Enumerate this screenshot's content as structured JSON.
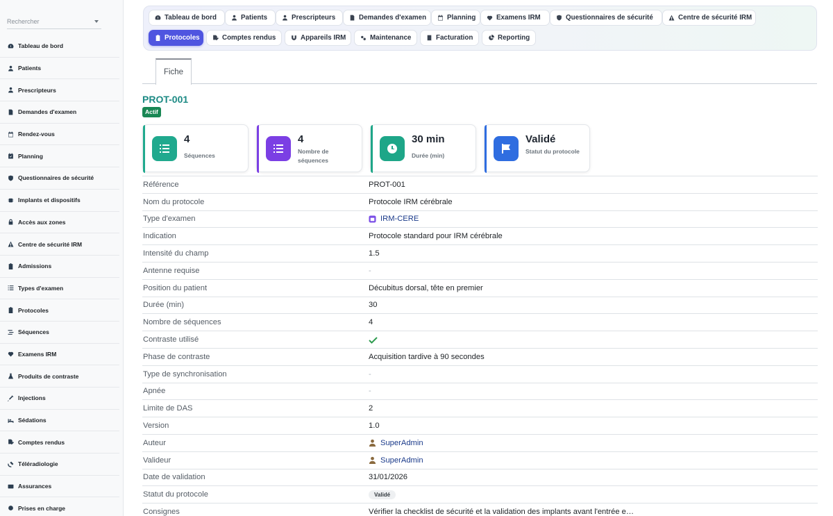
{
  "sidebar": {
    "search_placeholder": "Rechercher",
    "items": [
      {
        "label": "Tableau de bord",
        "icon": "gauge-icon"
      },
      {
        "label": "Patients",
        "icon": "user-icon"
      },
      {
        "label": "Prescripteurs",
        "icon": "user-doctor-icon"
      },
      {
        "label": "Demandes d'examen",
        "icon": "file-icon"
      },
      {
        "label": "Rendez-vous",
        "icon": "calendar-icon"
      },
      {
        "label": "Planning",
        "icon": "calendar-check-icon"
      },
      {
        "label": "Questionnaires de sécurité",
        "icon": "shield-icon"
      },
      {
        "label": "Implants et dispositifs",
        "icon": "microchip-icon"
      },
      {
        "label": "Accès aux zones",
        "icon": "lock-icon"
      },
      {
        "label": "Centre de sécurité IRM",
        "icon": "warning-icon"
      },
      {
        "label": "Admissions",
        "icon": "clipboard-icon"
      },
      {
        "label": "Types d'examen",
        "icon": "list-icon"
      },
      {
        "label": "Protocoles",
        "icon": "clipboard-list-icon"
      },
      {
        "label": "Séquences",
        "icon": "stream-icon"
      },
      {
        "label": "Examens IRM",
        "icon": "heartbeat-icon"
      },
      {
        "label": "Produits de contraste",
        "icon": "flask-icon"
      },
      {
        "label": "Injections",
        "icon": "syringe-icon"
      },
      {
        "label": "Sédations",
        "icon": "bed-icon"
      },
      {
        "label": "Comptes rendus",
        "icon": "file-signature-icon"
      },
      {
        "label": "Téléradiologie",
        "icon": "satellite-icon"
      },
      {
        "label": "Assurances",
        "icon": "id-card-icon"
      },
      {
        "label": "Prises en charge",
        "icon": "circle-icon"
      }
    ]
  },
  "topnav": {
    "row1": [
      {
        "label": "Tableau de bord",
        "icon": "gauge-icon"
      },
      {
        "label": "Patients",
        "icon": "user-icon"
      },
      {
        "label": "Prescripteurs",
        "icon": "user-doctor-icon"
      },
      {
        "label": "Demandes d'examen",
        "icon": "file-icon"
      },
      {
        "label": "Planning",
        "icon": "calendar-icon"
      },
      {
        "label": "Examens IRM",
        "icon": "heartbeat-icon"
      },
      {
        "label": "Questionnaires de sécurité",
        "icon": "shield-icon"
      },
      {
        "label": "Centre de sécurité IRM",
        "icon": "warning-icon"
      }
    ],
    "row2": [
      {
        "label": "Protocoles",
        "icon": "clipboard-icon",
        "active": true
      },
      {
        "label": "Comptes rendus",
        "icon": "file-signature-icon"
      },
      {
        "label": "Appareils IRM",
        "icon": "magnet-icon"
      },
      {
        "label": "Maintenance",
        "icon": "cogs-icon"
      },
      {
        "label": "Facturation",
        "icon": "invoice-icon"
      },
      {
        "label": "Reporting",
        "icon": "chart-pie-icon"
      }
    ]
  },
  "tab": {
    "label": "Fiche"
  },
  "record": {
    "title": "PROT-001",
    "status_badge": "Actif"
  },
  "cards": [
    {
      "value": "4",
      "label": "Séquences",
      "color": "#20a98e",
      "icon": "list-icon"
    },
    {
      "value": "4",
      "label": "Nombre de séquences",
      "color": "#7b3fe4",
      "icon": "list-icon"
    },
    {
      "value": "30 min",
      "label": "Durée (min)",
      "color": "#1ea688",
      "icon": "clock-icon"
    },
    {
      "value": "Validé",
      "label": "Statut du protocole",
      "color": "#2f6de0",
      "icon": "flag-icon"
    }
  ],
  "fields": [
    {
      "key": "Référence",
      "value": "PROT-001"
    },
    {
      "key": "Nom du protocole",
      "value": "Protocole IRM cérébrale"
    },
    {
      "key": "Type d'examen",
      "value": "IRM-CERE",
      "kind": "link-exam"
    },
    {
      "key": "Indication",
      "value": "Protocole standard pour IRM cérébrale"
    },
    {
      "key": "Intensité du champ",
      "value": "1.5"
    },
    {
      "key": "Antenne requise",
      "value": "-",
      "kind": "muted"
    },
    {
      "key": "Position du patient",
      "value": "Décubitus dorsal, tête en premier"
    },
    {
      "key": "Durée (min)",
      "value": "30"
    },
    {
      "key": "Nombre de séquences",
      "value": "4"
    },
    {
      "key": "Contraste utilisé",
      "value": "",
      "kind": "check"
    },
    {
      "key": "Phase de contraste",
      "value": "Acquisition tardive à 90 secondes"
    },
    {
      "key": "Type de synchronisation",
      "value": "-",
      "kind": "muted"
    },
    {
      "key": "Apnée",
      "value": "-",
      "kind": "muted"
    },
    {
      "key": "Limite de DAS",
      "value": "2"
    },
    {
      "key": "Version",
      "value": "1.0"
    },
    {
      "key": "Auteur",
      "value": "SuperAdmin",
      "kind": "link-user"
    },
    {
      "key": "Valideur",
      "value": "SuperAdmin",
      "kind": "link-user"
    },
    {
      "key": "Date de validation",
      "value": "31/01/2026"
    },
    {
      "key": "Statut du protocole",
      "value": "Validé",
      "kind": "chip"
    },
    {
      "key": "Consignes",
      "value": "Vérifier la checklist de sécurité et la validation des implants avant l'entrée e…"
    }
  ]
}
